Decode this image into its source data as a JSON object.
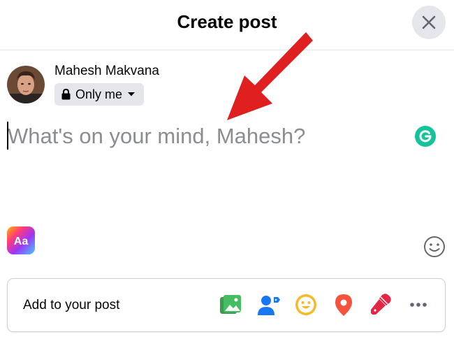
{
  "header": {
    "title": "Create post"
  },
  "user": {
    "name": "Mahesh Makvana",
    "privacy": "Only me"
  },
  "composer": {
    "placeholder": "What's on your mind, Mahesh?"
  },
  "add_bar": {
    "label": "Add to your post",
    "tools": [
      "photo-video-icon",
      "tag-people-icon",
      "feeling-icon",
      "check-in-icon",
      "host-qa-icon",
      "more-icon"
    ]
  },
  "colors": {
    "accent": "#1877f2",
    "photo": "#45bd62",
    "feeling": "#f7b928",
    "checkin": "#f5533d",
    "annotation": "#e02020"
  }
}
